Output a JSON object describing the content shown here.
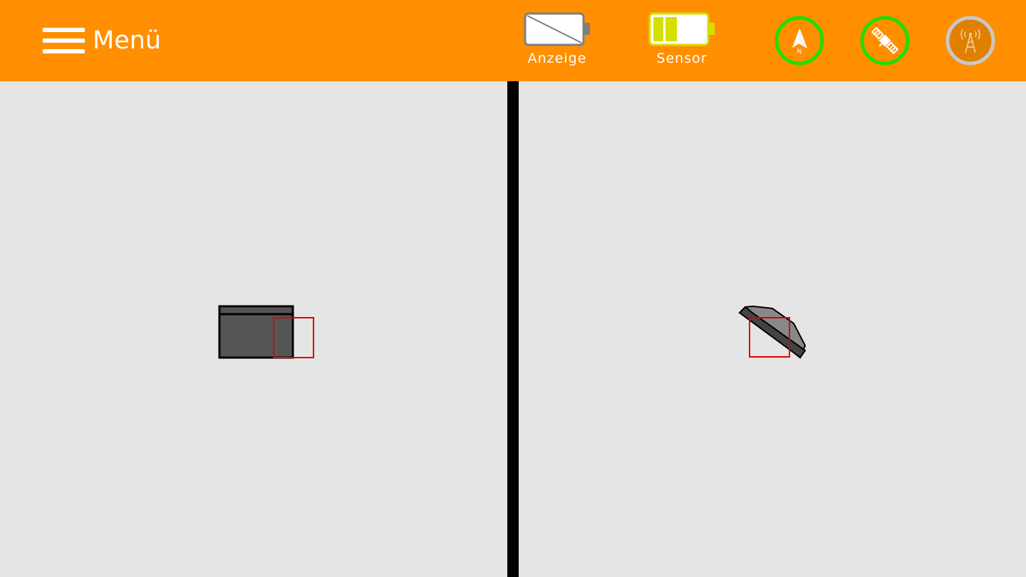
{
  "header": {
    "menu_label": "Menü",
    "batteries": [
      {
        "label": "Anzeige",
        "fill_level": 0,
        "color": "#ffffff"
      },
      {
        "label": "Sensor",
        "fill_level": 0.5,
        "color": "#d4e000"
      }
    ],
    "status_icons": [
      {
        "name": "compass-north-icon",
        "ring_color": "#22dd00",
        "active": true,
        "text": "N"
      },
      {
        "name": "satellite-icon",
        "ring_color": "#22dd00",
        "active": true
      },
      {
        "name": "radio-tower-icon",
        "ring_color": "#c8c8c8",
        "active": false
      }
    ]
  },
  "colors": {
    "accent": "#ff8f00",
    "background": "#e5e5e5",
    "machine_fill": "#555555",
    "target_marker": "#dd0000",
    "status_ok": "#22dd00"
  },
  "views": {
    "left": {
      "name": "side-view"
    },
    "right": {
      "name": "top-view"
    }
  }
}
